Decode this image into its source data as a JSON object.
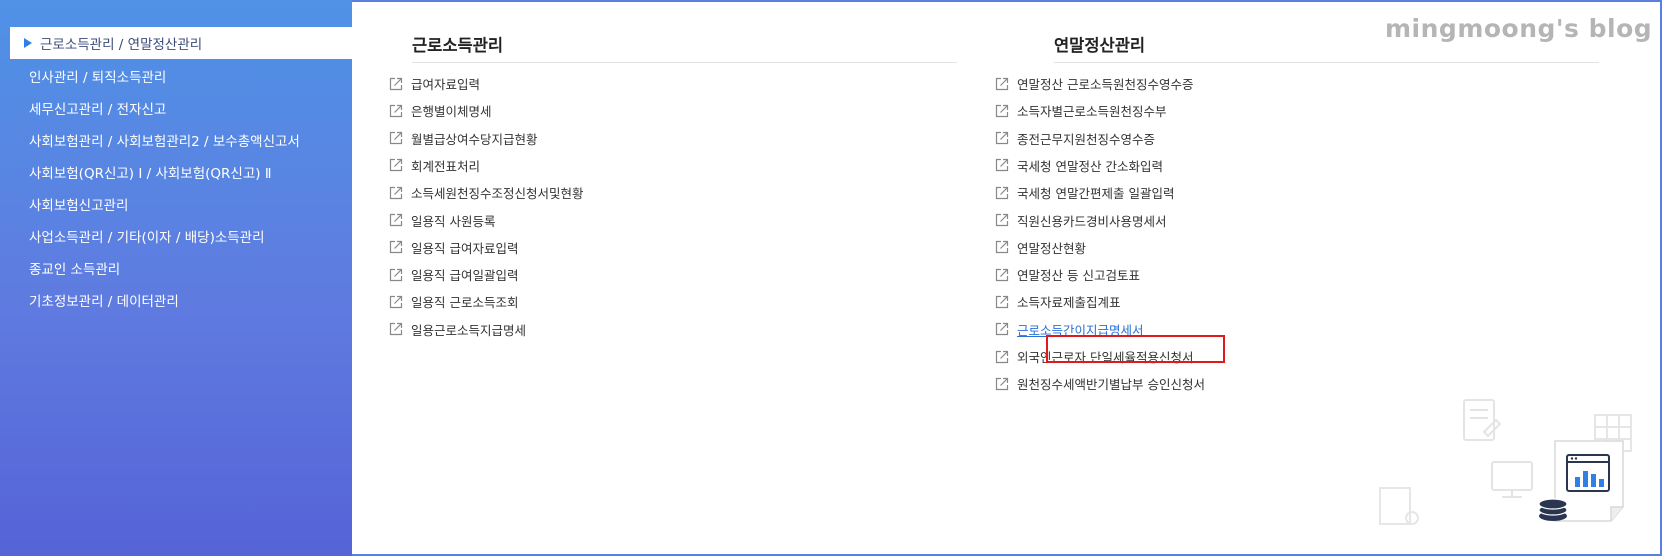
{
  "sidebar": {
    "active_label": "근로소득관리 / 연말정산관리",
    "items": [
      {
        "label": "인사관리 / 퇴직소득관리"
      },
      {
        "label": "세무신고관리 / 전자신고"
      },
      {
        "label": "사회보험관리 / 사회보험관리2 / 보수총액신고서"
      },
      {
        "label": "사회보험(QR신고) Ⅰ / 사회보험(QR신고) Ⅱ"
      },
      {
        "label": "사회보험신고관리"
      },
      {
        "label": "사업소득관리 / 기타(이자 / 배당)소득관리"
      },
      {
        "label": "종교인 소득관리"
      },
      {
        "label": "기초정보관리 / 데이터관리"
      }
    ]
  },
  "left_column": {
    "title": "근로소득관리",
    "links": [
      {
        "label": "급여자료입력"
      },
      {
        "label": "은행별이체명세"
      },
      {
        "label": "월별급상여수당지급현황"
      },
      {
        "label": "회계전표처리"
      },
      {
        "label": "소득세원천징수조정신청서및현황"
      },
      {
        "label": "일용직 사원등록"
      },
      {
        "label": "일용직 급여자료입력"
      },
      {
        "label": "일용직 급여일괄입력"
      },
      {
        "label": "일용직 근로소득조회"
      },
      {
        "label": "일용근로소득지급명세"
      }
    ]
  },
  "right_column": {
    "title": "연말정산관리",
    "links": [
      {
        "label": "연말정산 근로소득원천징수영수증"
      },
      {
        "label": "소득자별근로소득원천징수부"
      },
      {
        "label": "종전근무지원천징수영수증"
      },
      {
        "label": "국세청 연말정산 간소화입력"
      },
      {
        "label": "국세청 연말간편제출 일괄입력"
      },
      {
        "label": "직원신용카드경비사용명세서"
      },
      {
        "label": "연말정산현황"
      },
      {
        "label": "연말정산 등 신고검토표"
      },
      {
        "label": "소득자료제출집계표"
      },
      {
        "label": "근로소득간이지급명세서"
      },
      {
        "label": "외국인근로자 단일세율적용신청서"
      },
      {
        "label": "원천징수세액반기별납부 승인신청서"
      }
    ],
    "highlighted_index": 9
  },
  "watermark": "mingmoong's blog",
  "colors": {
    "accent": "#2f7fe8",
    "highlight_box": "#e01919",
    "link_highlight": "#2a6fd6"
  }
}
